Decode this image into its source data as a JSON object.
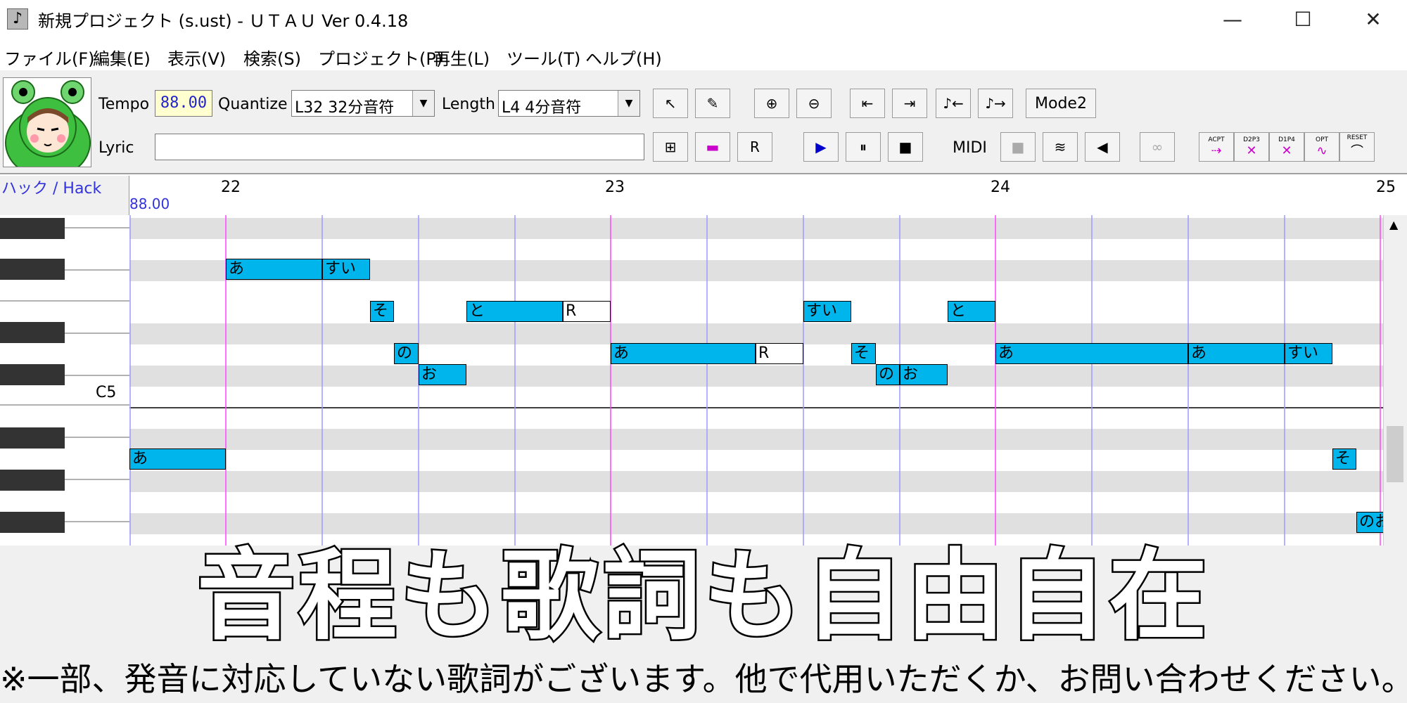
{
  "window": {
    "title": "新規プロジェクト (s.ust) - ＵＴＡＵ Ver 0.4.18",
    "minimize_glyph": "—",
    "maximize_glyph": "☐",
    "close_glyph": "✕"
  },
  "menu": {
    "items": [
      "ファイル(F)",
      "編集(E)",
      "表示(V)",
      "検索(S)",
      "プロジェクト(P)",
      "再生(L)",
      "ツール(T)",
      "ヘルプ(H)"
    ]
  },
  "toolbar": {
    "tempo_label": "Tempo",
    "tempo_value": "88.00",
    "quantize_label": "Quantize",
    "quantize_value": "L32 32分音符",
    "length_label": "Length",
    "length_value": "L4  4分音符",
    "lyric_label": "Lyric",
    "lyric_value": "",
    "mode_button": "Mode2",
    "midi_label": "MIDI",
    "acpt_label": "ACPT",
    "d2p3_label": "D2P3",
    "d1p4_label": "D1P4",
    "opt_label": "OPT",
    "reset_label": "RESET"
  },
  "track": {
    "name": "ハック / Hack",
    "tempo_marker": "88.00",
    "measures": [
      "22",
      "23",
      "24",
      "25"
    ],
    "key_label": "C5"
  },
  "notes": [
    {
      "lyric": "あ"
    },
    {
      "lyric": "すい"
    },
    {
      "lyric": "そ"
    },
    {
      "lyric": "と"
    },
    {
      "lyric": "R"
    },
    {
      "lyric": "すい"
    },
    {
      "lyric": "と"
    },
    {
      "lyric": "の"
    },
    {
      "lyric": "あ"
    },
    {
      "lyric": "R"
    },
    {
      "lyric": "そ"
    },
    {
      "lyric": "あ"
    },
    {
      "lyric": "あ"
    },
    {
      "lyric": "すい"
    },
    {
      "lyric": "お"
    },
    {
      "lyric": "の"
    },
    {
      "lyric": "お"
    },
    {
      "lyric": "あ"
    },
    {
      "lyric": "そ"
    },
    {
      "lyric": "のお"
    }
  ],
  "caption": {
    "main": "音程も歌詞も自由自在",
    "sub": "※一部、発音に対応していない歌詞がございます。他で代用いただくか、お問い合わせください。"
  },
  "colors": {
    "note_fill": "#00b4ec",
    "beat_line": "#9a9aff",
    "measure_line": "#ff44ff",
    "black_row": "#e0e0e0"
  }
}
